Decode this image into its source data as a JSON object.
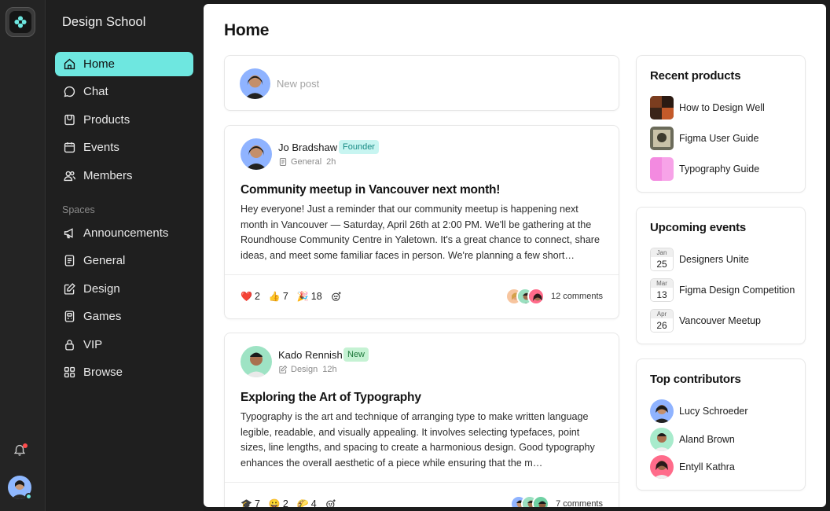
{
  "sidebar": {
    "brand": "Design School",
    "nav": [
      {
        "label": "Home",
        "icon": "home-icon",
        "active": true
      },
      {
        "label": "Chat",
        "icon": "chat-icon"
      },
      {
        "label": "Products",
        "icon": "products-icon"
      },
      {
        "label": "Events",
        "icon": "calendar-icon"
      },
      {
        "label": "Members",
        "icon": "members-icon"
      }
    ],
    "spaces_label": "Spaces",
    "spaces": [
      {
        "label": "Announcements",
        "icon": "megaphone-icon"
      },
      {
        "label": "General",
        "icon": "document-icon"
      },
      {
        "label": "Design",
        "icon": "pencil-square-icon"
      },
      {
        "label": "Games",
        "icon": "gamepad-icon"
      },
      {
        "label": "VIP",
        "icon": "lock-icon"
      },
      {
        "label": "Browse",
        "icon": "grid-icon"
      }
    ]
  },
  "accent_color": "#6ee7e0",
  "main": {
    "title": "Home",
    "new_post_placeholder": "New post",
    "posts": [
      {
        "author": "Jo Bradshaw",
        "badge": "Founder",
        "space": "General",
        "time": "2h",
        "title": "Community meetup in Vancouver next month!",
        "body": "Hey everyone! Just a reminder that our community meetup is happening next month in Vancouver — Saturday, April 26th at 2:00 PM. We'll be gathering at the Roundhouse Community Centre in Yaletown. It's a great chance to connect, share ideas, and meet some familiar faces in person. We're planning a few short…",
        "reactions": [
          {
            "emoji": "❤️",
            "count": "2"
          },
          {
            "emoji": "👍",
            "count": "7"
          },
          {
            "emoji": "🎉",
            "count": "18"
          }
        ],
        "comments": "12 comments"
      },
      {
        "author": "Kado Rennish",
        "badge": "New",
        "space": "Design",
        "time": "12h",
        "title": "Exploring the Art of Typography",
        "body": "Typography is the art and technique of arranging type to make written language legible, readable, and visually appealing. It involves selecting typefaces, point sizes, line lengths, and spacing to create a harmonious design. Good typography enhances the overall aesthetic of a piece while ensuring that the m…",
        "reactions": [
          {
            "emoji": "🎓",
            "count": "7"
          },
          {
            "emoji": "😀",
            "count": "2"
          },
          {
            "emoji": "🌮",
            "count": "4"
          }
        ],
        "comments": "7 comments"
      }
    ]
  },
  "right": {
    "recent_products": {
      "title": "Recent products",
      "items": [
        "How to Design Well",
        "Figma User Guide",
        "Typography Guide"
      ]
    },
    "upcoming_events": {
      "title": "Upcoming events",
      "items": [
        {
          "month": "Jan",
          "day": "25",
          "name": "Designers Unite"
        },
        {
          "month": "Mar",
          "day": "13",
          "name": "Figma Design Competition"
        },
        {
          "month": "Apr",
          "day": "26",
          "name": "Vancouver Meetup"
        }
      ]
    },
    "top_contributors": {
      "title": "Top contributors",
      "items": [
        "Lucy Schroeder",
        "Aland Brown",
        "Entyll Kathra"
      ]
    }
  }
}
